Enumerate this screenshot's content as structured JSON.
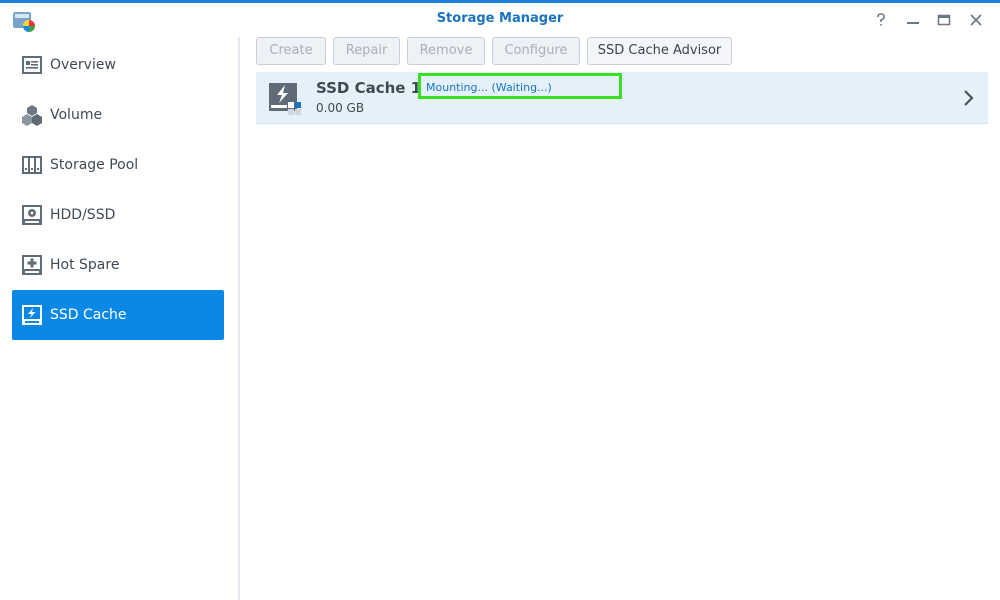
{
  "window": {
    "title": "Storage Manager",
    "controls": [
      "help-icon",
      "minimize-icon",
      "maximize-icon",
      "close-icon"
    ]
  },
  "sidebar": {
    "items": [
      {
        "label": "Overview",
        "icon": "overview-icon",
        "active": false
      },
      {
        "label": "Volume",
        "icon": "volume-icon",
        "active": false
      },
      {
        "label": "Storage Pool",
        "icon": "storage-pool-icon",
        "active": false
      },
      {
        "label": "HDD/SSD",
        "icon": "hdd-icon",
        "active": false
      },
      {
        "label": "Hot Spare",
        "icon": "hot-spare-icon",
        "active": false
      },
      {
        "label": "SSD Cache",
        "icon": "ssd-cache-icon",
        "active": true
      }
    ]
  },
  "toolbar": {
    "create_label": "Create",
    "repair_label": "Repair",
    "remove_label": "Remove",
    "configure_label": "Configure",
    "advisor_label": "SSD Cache Advisor"
  },
  "cache": {
    "name": "SSD Cache 1",
    "separator": "-",
    "status": "Mounting... (Waiting...)",
    "size": "0.00 GB"
  },
  "colors": {
    "accent": "#0b88e5",
    "title": "#1a73c0",
    "highlight": "#3be01e",
    "row_bg": "#e4f1fb"
  }
}
